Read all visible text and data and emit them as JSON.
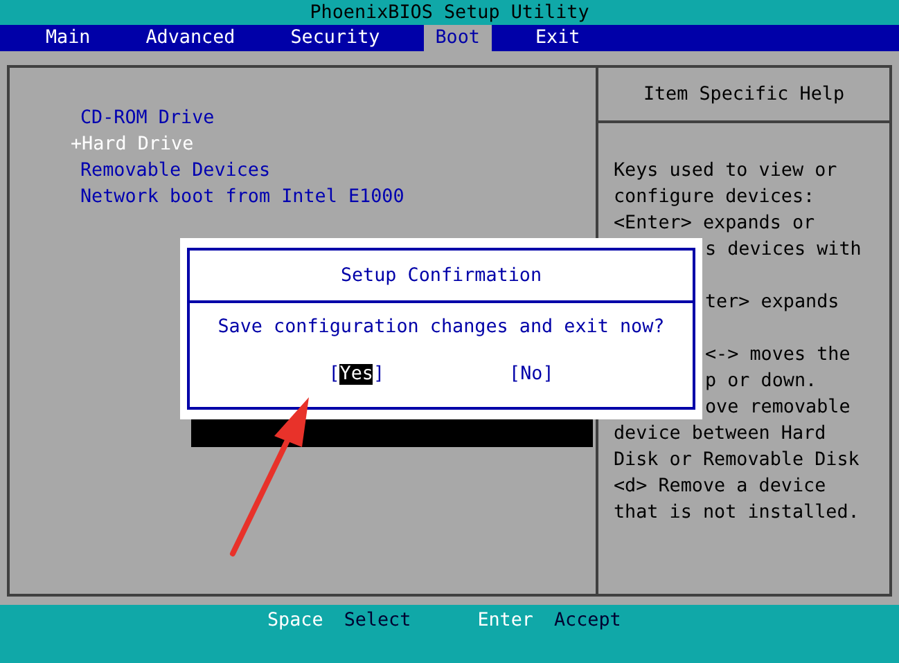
{
  "window": {
    "title": "PhoenixBIOS Setup Utility"
  },
  "tabs": [
    {
      "label": "Main",
      "selected": false
    },
    {
      "label": "Advanced",
      "selected": false
    },
    {
      "label": "Security",
      "selected": false
    },
    {
      "label": "Boot",
      "selected": true
    },
    {
      "label": "Exit",
      "selected": false
    }
  ],
  "boot_items": [
    {
      "label": "CD-ROM Drive",
      "selected": false
    },
    {
      "label": "+Hard Drive",
      "selected": true
    },
    {
      "label": "Removable Devices",
      "selected": false
    },
    {
      "label": "Network boot from Intel E1000",
      "selected": false
    }
  ],
  "help": {
    "title": "Item Specific Help",
    "paragraphs": [
      [
        {
          "text": "Keys used to view or",
          "kind": "full"
        },
        {
          "text": "configure devices:",
          "kind": "full"
        },
        {
          "text": "<Enter> expands or",
          "kind": "full"
        },
        {
          "text": "s devices with",
          "kind": "cut"
        }
      ],
      [
        {
          "text": "ter> expands",
          "kind": "cut"
        }
      ],
      [
        {
          "text": "<-> moves the",
          "kind": "cut"
        },
        {
          "text": "p or down.",
          "kind": "cut"
        },
        {
          "text": "ove removable",
          "kind": "cut"
        },
        {
          "text": "device between Hard",
          "kind": "full"
        },
        {
          "text": "Disk or Removable Disk",
          "kind": "full"
        },
        {
          "text": "<d> Remove a device",
          "kind": "full"
        },
        {
          "text": "that is not installed.",
          "kind": "full"
        }
      ]
    ]
  },
  "dialog": {
    "title": "Setup Confirmation",
    "message": "Save configuration changes and exit now?",
    "buttons": [
      {
        "left": "[",
        "label": "Yes",
        "right": "]",
        "selected": true
      },
      {
        "left": "[",
        "label": "No",
        "right": "]",
        "selected": false
      }
    ]
  },
  "status_bar": [
    {
      "key": "Space",
      "action": "Select"
    },
    {
      "key": "Enter",
      "action": "Accept"
    }
  ]
}
